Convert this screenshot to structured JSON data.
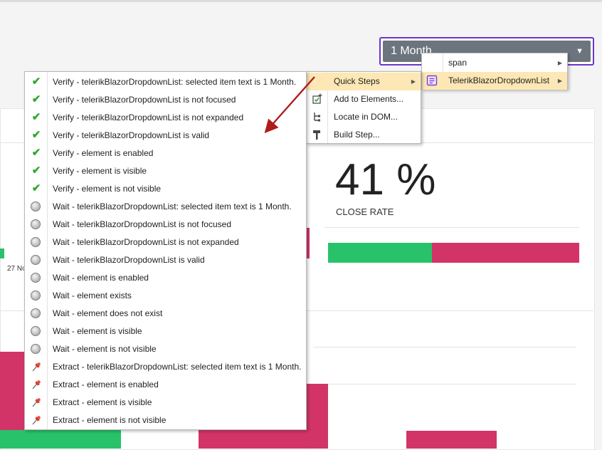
{
  "dropdown": {
    "selected": "1 Month",
    "caret": "▼"
  },
  "dashboard": {
    "close_rate_value": "41 %",
    "close_rate_label": "CLOSE RATE",
    "date_fragment": "27 No"
  },
  "element_menu": {
    "items": [
      {
        "label": "span",
        "icon": "none",
        "highlighted": false
      },
      {
        "label": "TelerikBlazorDropdownList",
        "icon": "component-icon",
        "highlighted": true
      }
    ]
  },
  "action_menu": {
    "items": [
      {
        "label": "Quick Steps",
        "icon": "none",
        "highlighted": true,
        "submenu": true
      },
      {
        "label": "Add to Elements...",
        "icon": "add-element-icon"
      },
      {
        "label": "Locate in DOM...",
        "icon": "dom-tree-icon"
      },
      {
        "label": "Build Step...",
        "icon": "hammer-icon"
      }
    ]
  },
  "quick_steps": {
    "items": [
      {
        "label": "Verify - telerikBlazorDropdownList: selected item text is 1 Month.",
        "icon": "check-icon"
      },
      {
        "label": "Verify - telerikBlazorDropdownList is not focused",
        "icon": "check-icon"
      },
      {
        "label": "Verify - telerikBlazorDropdownList is not expanded",
        "icon": "check-icon"
      },
      {
        "label": "Verify - telerikBlazorDropdownList is valid",
        "icon": "check-icon"
      },
      {
        "label": "Verify - element is enabled",
        "icon": "check-icon"
      },
      {
        "label": "Verify - element is visible",
        "icon": "check-icon"
      },
      {
        "label": "Verify - element is not visible",
        "icon": "check-icon"
      },
      {
        "label": "Wait - telerikBlazorDropdownList: selected item text is 1 Month.",
        "icon": "clock-icon"
      },
      {
        "label": "Wait - telerikBlazorDropdownList is not focused",
        "icon": "clock-icon"
      },
      {
        "label": "Wait - telerikBlazorDropdownList is not expanded",
        "icon": "clock-icon"
      },
      {
        "label": "Wait - telerikBlazorDropdownList is valid",
        "icon": "clock-icon"
      },
      {
        "label": "Wait - element is enabled",
        "icon": "clock-icon"
      },
      {
        "label": "Wait - element exists",
        "icon": "clock-icon"
      },
      {
        "label": "Wait - element does not exist",
        "icon": "clock-icon"
      },
      {
        "label": "Wait - element is visible",
        "icon": "clock-icon"
      },
      {
        "label": "Wait - element is not visible",
        "icon": "clock-icon"
      },
      {
        "label": "Extract - telerikBlazorDropdownList: selected item text is 1 Month.",
        "icon": "pin-icon"
      },
      {
        "label": "Extract - element is enabled",
        "icon": "pin-icon"
      },
      {
        "label": "Extract - element is visible",
        "icon": "pin-icon"
      },
      {
        "label": "Extract - element is not visible",
        "icon": "pin-icon"
      }
    ]
  },
  "colors": {
    "dropdown_border": "#6b35c9",
    "dropdown_bg": "#6c757d",
    "success": "#28c26a",
    "danger": "#d33467",
    "highlight": "#fde8b5",
    "annotation_arrow": "#b01c1c"
  }
}
